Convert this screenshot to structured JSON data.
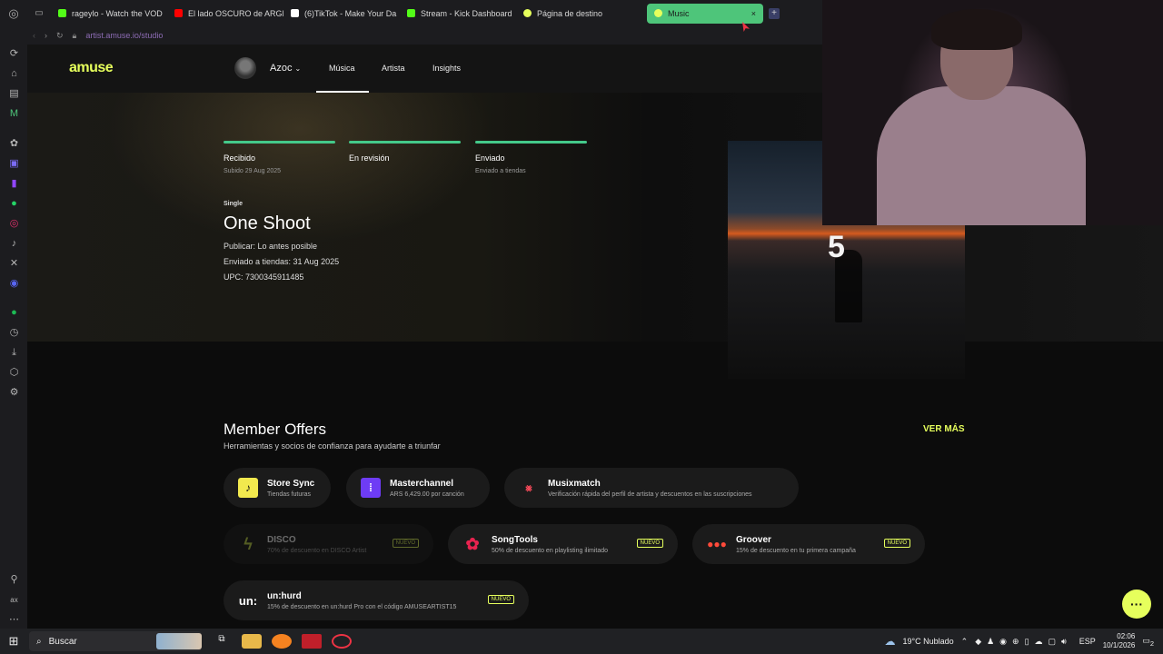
{
  "browser": {
    "tabs": [
      {
        "label": "rageylo - Watch the VOD",
        "color": "#53fc18"
      },
      {
        "label": "El lado OSCURO de ARGE",
        "color": "#ff0000"
      },
      {
        "label": "(6)TikTok - Make Your Da",
        "color": "#ffffff"
      },
      {
        "label": "Stream - Kick Dashboard",
        "color": "#53fc18"
      },
      {
        "label": "Página de destino",
        "color": "#e6ff5c"
      }
    ],
    "active_tab": {
      "label": "Music",
      "close": "×"
    },
    "new_tab": "+",
    "url": "artist.amuse.io/studio"
  },
  "sidebar_icons": [
    "refresh-icon",
    "home-icon",
    "chart-icon",
    "m-icon",
    "openai-icon",
    "cs-icon",
    "twitch-icon",
    "whatsapp-icon",
    "instagram-icon",
    "tiktok-icon",
    "x-icon",
    "discord-icon",
    "spotify-icon",
    "history-icon",
    "download-icon",
    "extensions-icon",
    "settings-icon",
    "pin-icon",
    "ax-icon",
    "more-icon"
  ],
  "nav": {
    "logo": "amuse",
    "artist": "Azoc",
    "links": [
      "Música",
      "Artista",
      "Insights"
    ]
  },
  "release": {
    "steps": [
      {
        "title": "Recibido",
        "sub": "Subido 29 Aug 2025"
      },
      {
        "title": "En revisión",
        "sub": ""
      },
      {
        "title": "Enviado",
        "sub": "Enviado a tiendas"
      }
    ],
    "type": "Single",
    "title": "One Shoot",
    "publish": "Publicar: Lo antes posible",
    "sent": "Enviado a tiendas: 31 Aug 2025",
    "upc": "UPC: 7300345911485",
    "cover_text": "5"
  },
  "offers": {
    "heading": "Member Offers",
    "subheading": "Herramientas y socios de confianza para ayudarte a triunfar",
    "see_more": "VER MÁS",
    "cards": [
      {
        "name": "Store Sync",
        "desc": "Tiendas futuras",
        "badge": "",
        "icon_color": "#f2e94e"
      },
      {
        "name": "Masterchannel",
        "desc": "ARS 6,429.00 por canción",
        "badge": "",
        "icon_color": "#6e3cf5"
      },
      {
        "name": "Musixmatch",
        "desc": "Verificación rápida del perfil de artista y descuentos en las suscripciones",
        "badge": "",
        "icon_color": "#ff4b5c"
      },
      {
        "name": "DISCO",
        "desc": "70% de descuento en DISCO Artist",
        "badge": "NUEVO",
        "icon_color": "#c9e04a"
      },
      {
        "name": "SongTools",
        "desc": "50% de descuento en playlisting ilimitado",
        "badge": "NUEVO",
        "icon_color": "#e8234f"
      },
      {
        "name": "Groover",
        "desc": "15% de descuento en tu primera campaña",
        "badge": "NUEVO",
        "icon_color": "#ff4a3a"
      },
      {
        "name": "un:hurd",
        "desc": "15% de descuento en un:hurd Pro con el código AMUSEARTIST15",
        "badge": "NUEVO",
        "icon_color": "#ffffff"
      }
    ]
  },
  "taskbar": {
    "search": "Buscar",
    "weather": "19°C Nublado",
    "lang": "ESP",
    "time": "02:06",
    "date": "10/1/2026",
    "notif": "2"
  }
}
